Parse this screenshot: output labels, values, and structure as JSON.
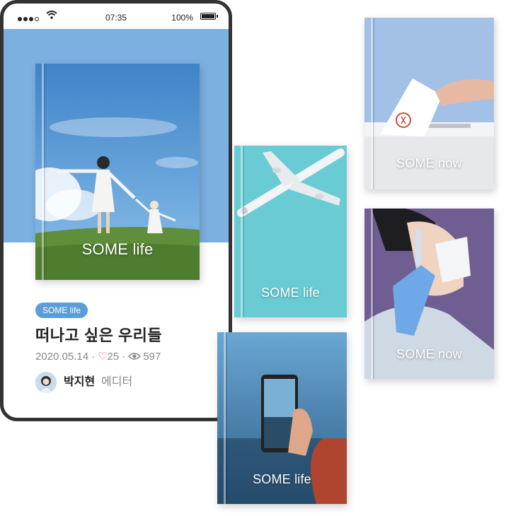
{
  "status_bar": {
    "time": "07:35",
    "battery": "100%"
  },
  "post": {
    "category": "SOME life",
    "cover_title": "SOME life",
    "title": "떠나고 싶은 우리들",
    "date": "2020.05.14",
    "likes": "25",
    "views": "597"
  },
  "author": {
    "name": "박지현",
    "role": "에디터"
  },
  "cards": [
    {
      "title": "SOME life"
    },
    {
      "title": "SOME life"
    },
    {
      "title": "SOME now"
    },
    {
      "title": "SOME now"
    }
  ],
  "colors": {
    "accent": "#5b9ddb",
    "hero_bg": "#7cb0e0",
    "phone_frame": "#333333"
  }
}
